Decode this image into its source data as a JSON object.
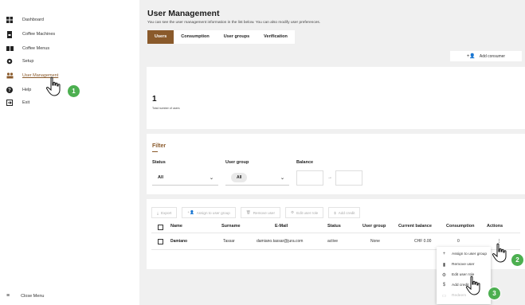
{
  "sidebar": {
    "items": [
      {
        "label": "Dashboard",
        "icon": "dashboard-icon"
      },
      {
        "label": "Coffee Machines",
        "icon": "coffee-machine-icon"
      },
      {
        "label": "Coffee Menus",
        "icon": "book-icon"
      },
      {
        "label": "Setup",
        "icon": "gear-icon"
      },
      {
        "label": "User Management",
        "icon": "users-icon"
      },
      {
        "label": "Help",
        "icon": "help-icon"
      },
      {
        "label": "Exit",
        "icon": "exit-icon"
      }
    ],
    "close_menu": "Close Menu"
  },
  "header": {
    "title": "User Management",
    "subtitle": "You can see the user management information in the list below. You can also modify user preferences."
  },
  "tabs": [
    "Users",
    "Consumption",
    "User groups",
    "Verification"
  ],
  "add_consumer": "Add consumer",
  "stats": {
    "count": "1",
    "label": "Total number of users"
  },
  "filter": {
    "title": "Filter",
    "status_label": "Status",
    "status_value": "All",
    "group_label": "User group",
    "group_value": "All",
    "balance_label": "Balance",
    "balance_arrow": "→"
  },
  "toolbar": {
    "export": "Export",
    "assign": "Assign to user group",
    "remove": "Remove user",
    "edit_role": "Edit user role",
    "add_credit": "Add credit"
  },
  "table": {
    "headers": [
      "Name",
      "Surname",
      "E-Mail",
      "Status",
      "User group",
      "Current balance",
      "Consumption",
      "Actions"
    ],
    "rows": [
      {
        "name": "Damiano",
        "surname": "Tassar",
        "email": "damiano.tassar@jura.com",
        "status": "active",
        "group": "None",
        "balance": "CHF 0.00",
        "consumption": "0",
        "actions": "⋮"
      }
    ]
  },
  "context_menu": {
    "items": [
      {
        "label": "Assign to user group",
        "icon": "user-add-icon"
      },
      {
        "label": "Remove user",
        "icon": "trash-icon"
      },
      {
        "label": "Edit user role",
        "icon": "gear-icon"
      },
      {
        "label": "Add credit",
        "icon": "dollar-icon"
      },
      {
        "label": "Redeem",
        "icon": "redeem-icon"
      }
    ]
  },
  "steps": [
    "1",
    "2",
    "3"
  ],
  "colors": {
    "accent": "#8a5a2b",
    "badge": "#4caf50",
    "background": "#f0f0f0"
  }
}
